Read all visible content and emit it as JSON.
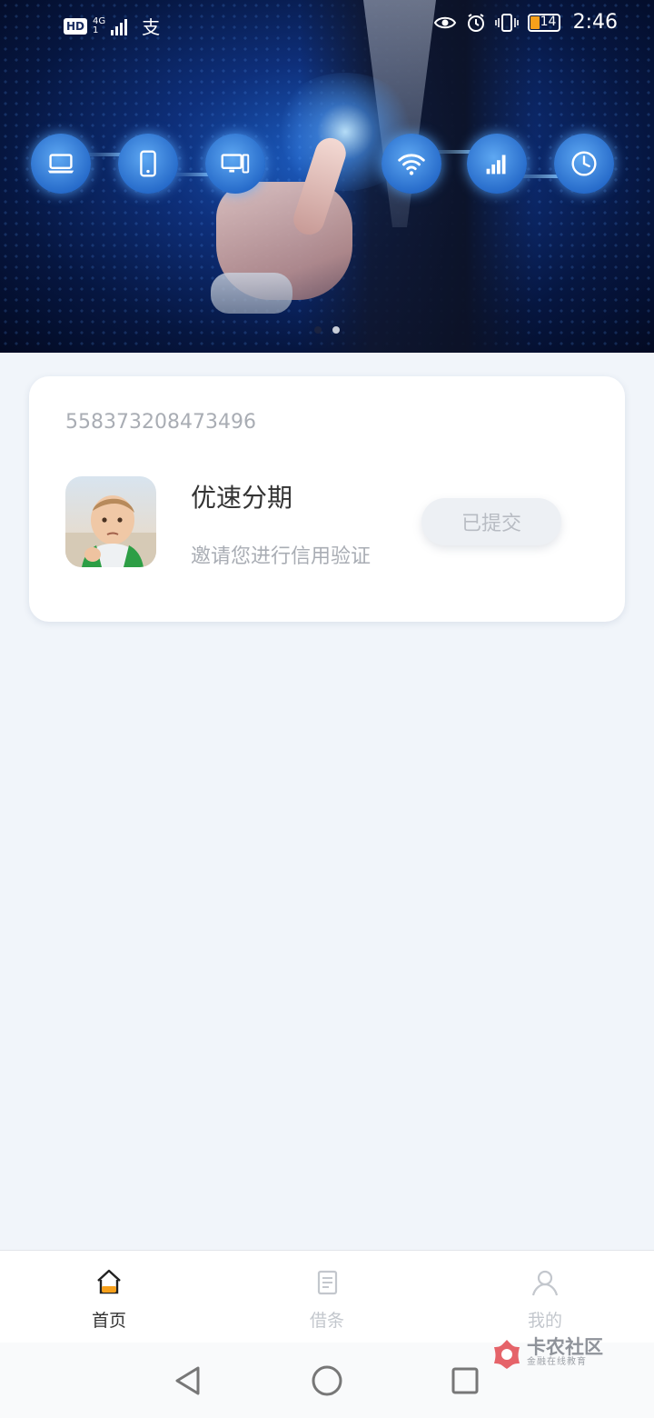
{
  "status_bar": {
    "hd_label": "HD",
    "network_type": "4G",
    "network_sub": "1",
    "left_app_glyph": "支",
    "battery_level": "14",
    "time": "2:46"
  },
  "banner": {
    "icons": [
      "laptop-icon",
      "phone-icon",
      "desktop-icon",
      "wifi-icon",
      "signal-bars-icon",
      "clock-icon"
    ],
    "page_indicator": {
      "total": 2,
      "active_index": 1
    }
  },
  "card": {
    "id_number": "558373208473496",
    "app_name": "优速分期",
    "subtitle": "邀请您进行信用验证",
    "button_label": "已提交"
  },
  "tabbar": {
    "tabs": [
      {
        "label": "首页",
        "icon": "home-icon",
        "active": true
      },
      {
        "label": "借条",
        "icon": "document-icon",
        "active": false
      },
      {
        "label": "我的",
        "icon": "user-icon",
        "active": false
      }
    ]
  },
  "watermark": {
    "main": "卡农社区",
    "sub": "金融在线教育"
  },
  "colors": {
    "page_bg": "#f1f5fa",
    "accent_orange": "#f7a01b",
    "text_dark": "#333333",
    "text_muted": "#a9adb4",
    "tab_inactive": "#c3c7cd"
  }
}
